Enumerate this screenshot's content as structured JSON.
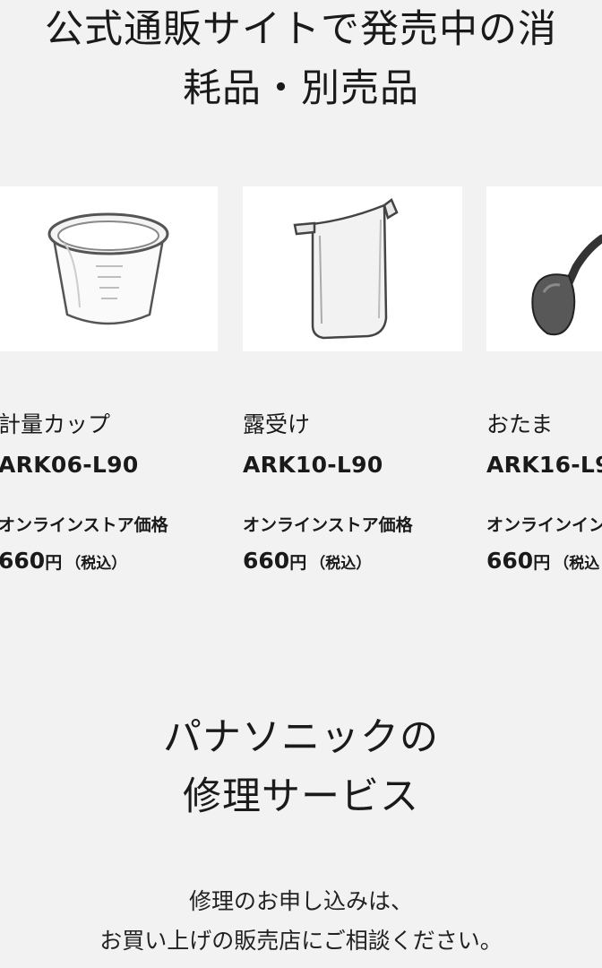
{
  "consumables": {
    "title_line1": "公式通販サイトで発売中の消",
    "title_line2": "耗品・別売品",
    "products": [
      {
        "name": "計量カップ",
        "model": "ARK06-L90",
        "price_label": "オンラインストア価格",
        "price": "660",
        "currency": "円",
        "tax_note": "（税込）",
        "icon": "measuring-cup-icon"
      },
      {
        "name": "露受け",
        "model": "ARK10-L90",
        "price_label": "オンラインストア価格",
        "price": "660",
        "currency": "円",
        "tax_note": "（税込）",
        "icon": "dew-tray-icon"
      },
      {
        "name": "おたま",
        "model": "ARK16-L9",
        "price_label": "オンラインインス",
        "price": "660",
        "currency": "円",
        "tax_note": "（税込",
        "icon": "ladle-icon"
      }
    ]
  },
  "repair": {
    "title_line1": "パナソニックの",
    "title_line2": "修理サービス",
    "notice_line1": "修理のお申し込みは、",
    "notice_line2": "お買い上げの販売店にご相談ください。"
  }
}
